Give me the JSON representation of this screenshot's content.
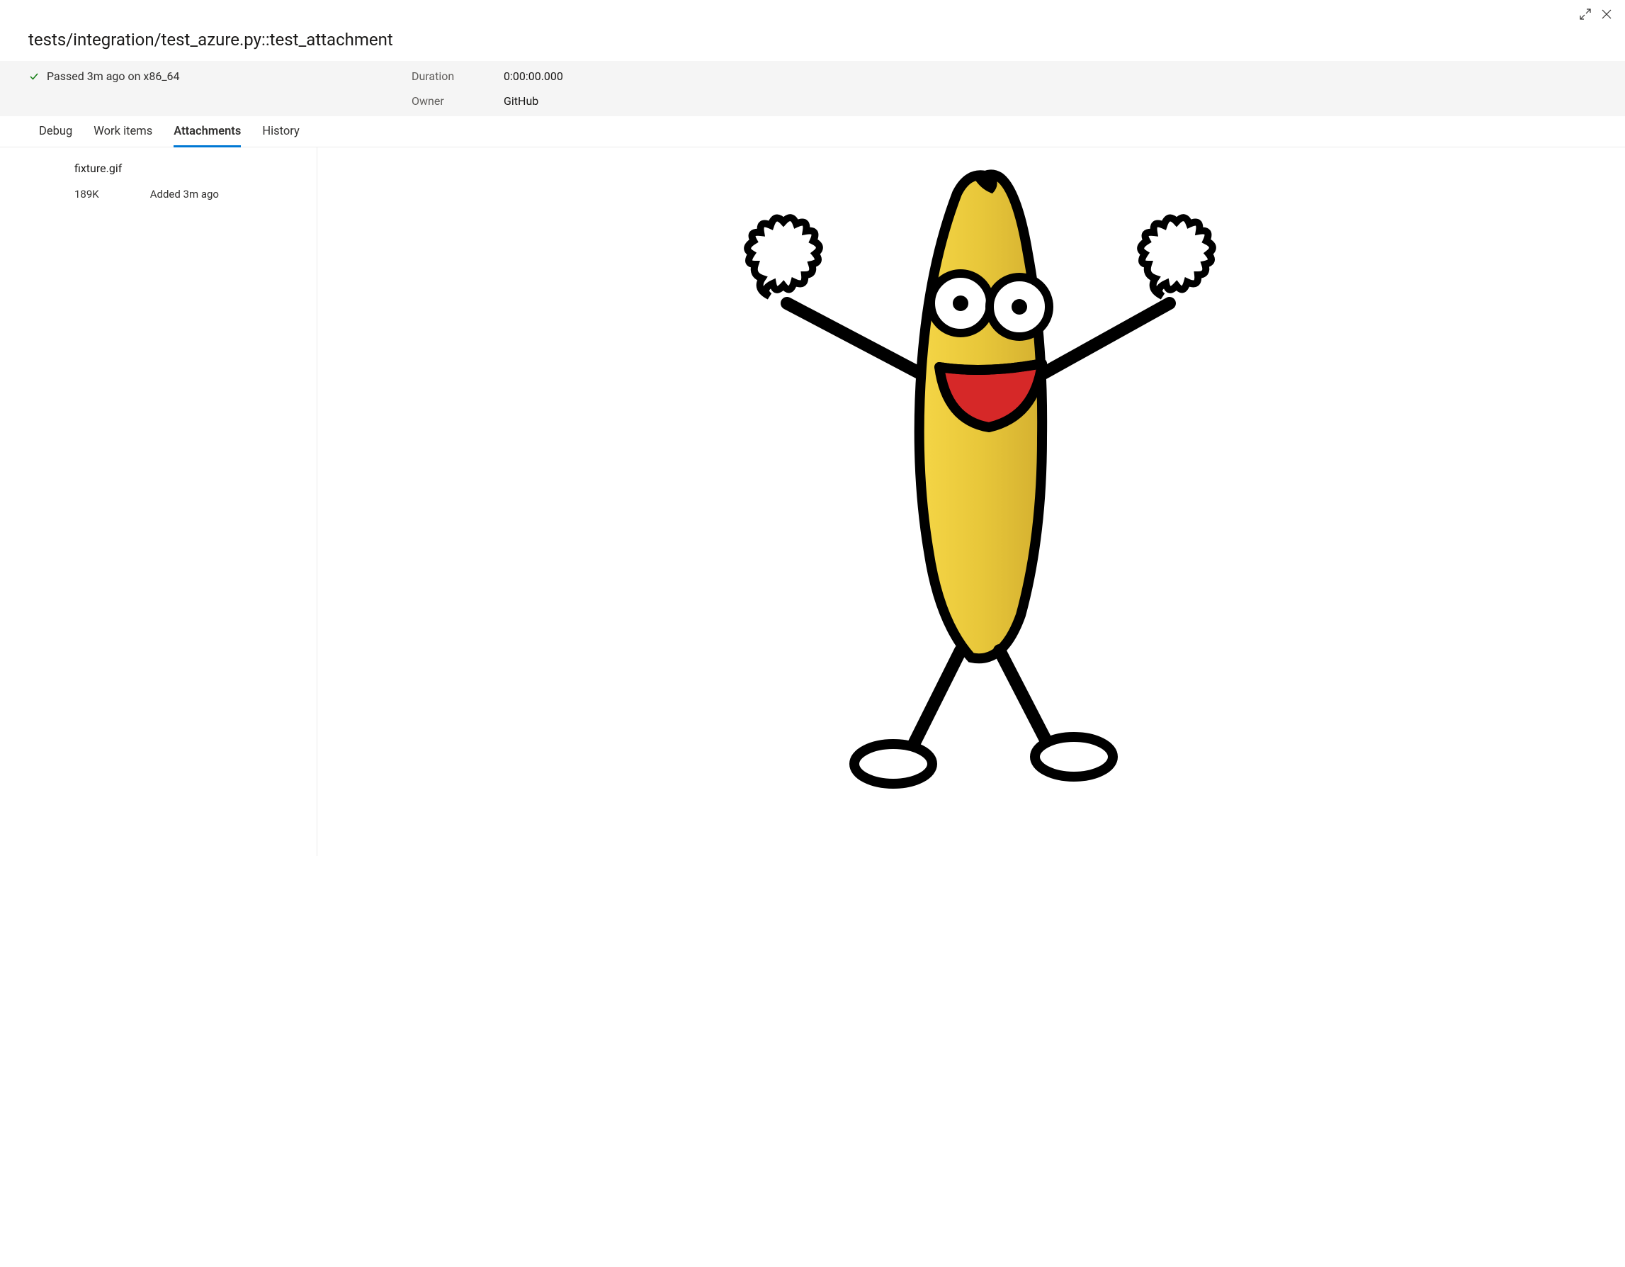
{
  "header": {
    "title": "tests/integration/test_azure.py::test_attachment"
  },
  "status": {
    "text": "Passed 3m ago on x86_64",
    "meta": [
      {
        "label": "Duration",
        "value": "0:00:00.000"
      },
      {
        "label": "Owner",
        "value": "GitHub"
      }
    ]
  },
  "tabs": [
    {
      "label": "Debug",
      "active": false
    },
    {
      "label": "Work items",
      "active": false
    },
    {
      "label": "Attachments",
      "active": true
    },
    {
      "label": "History",
      "active": false
    }
  ],
  "attachments": [
    {
      "name": "fixture.gif",
      "size": "189K",
      "added": "Added 3m ago"
    }
  ],
  "preview": {
    "description": "dancing-banana-cartoon"
  }
}
